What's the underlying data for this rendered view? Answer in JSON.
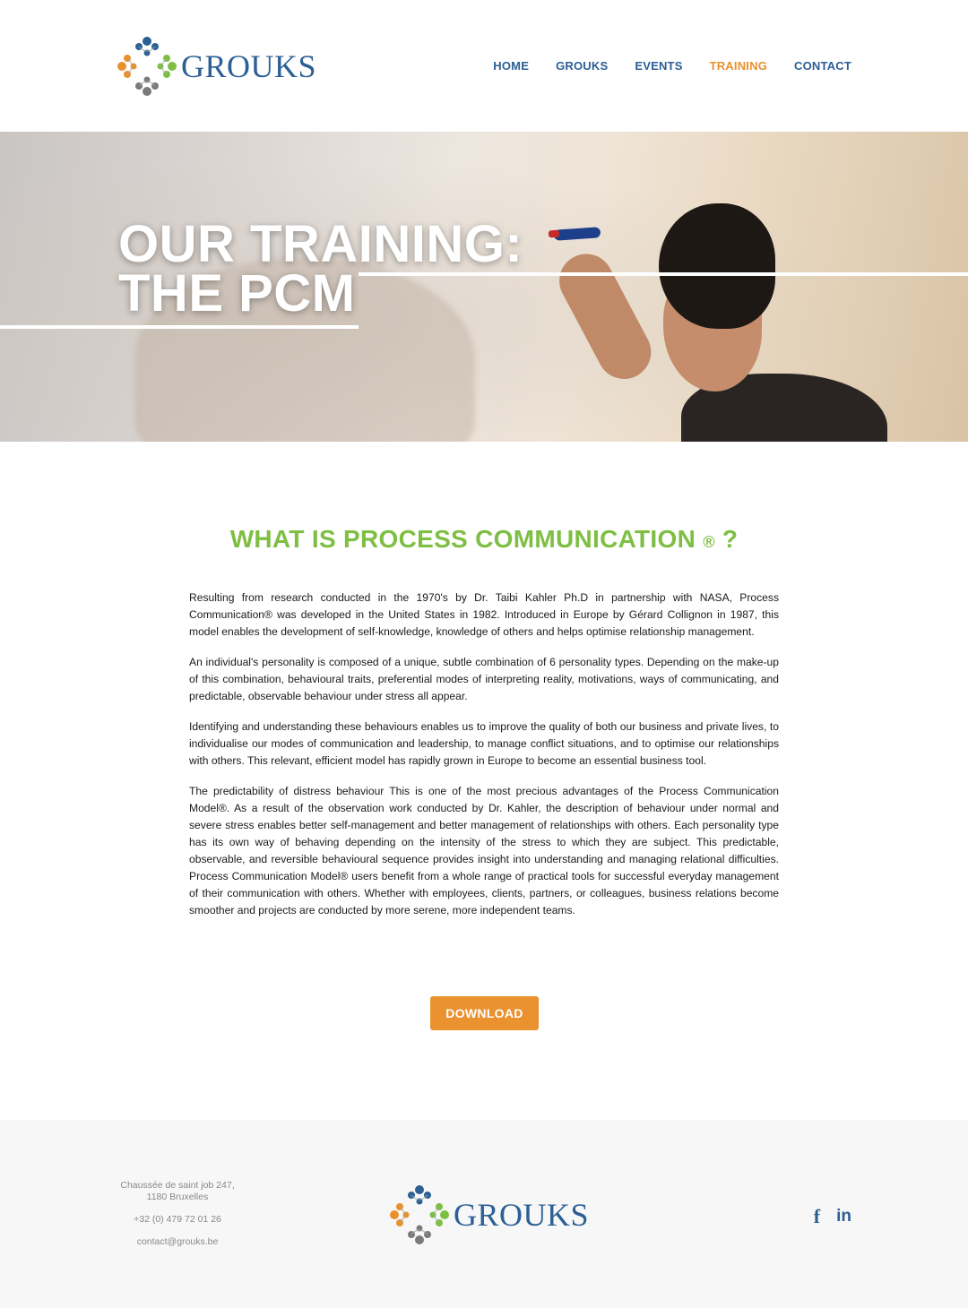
{
  "header": {
    "logo_text": "GROUKS",
    "nav": [
      {
        "label": "HOME",
        "active": false
      },
      {
        "label": "GROUKS",
        "active": false
      },
      {
        "label": "EVENTS",
        "active": false
      },
      {
        "label": "TRAINING",
        "active": true
      },
      {
        "label": "CONTACT",
        "active": false
      }
    ]
  },
  "hero": {
    "title_line1": "OUR TRAINING:",
    "title_line2": "THE PCM"
  },
  "content": {
    "heading": "WHAT IS PROCESS COMMUNICATION",
    "heading_reg": "®",
    "heading_q": "?",
    "paragraphs": [
      "Resulting from research conducted in the 1970's by Dr. Taibi Kahler Ph.D in partnership with NASA, Process Communication® was developed in the United States in 1982. Introduced in Europe by Gérard Collignon in 1987, this model enables the development of self-knowledge, knowledge of others and helps optimise relationship management.",
      "An individual's personality is composed of a unique, subtle combination of 6 personality types. Depending on the make-up of this combination, behavioural traits, preferential modes of interpreting reality, motivations, ways of communicating, and predictable, observable behaviour under stress all appear.",
      "Identifying and understanding these behaviours enables us to improve the quality of both our business and private lives, to individualise our modes of communication and leadership, to manage conflict situations, and to optimise our relationships with others. This relevant, efficient model has rapidly grown in Europe to become an essential business tool.",
      "The predictability of distress behaviour This is one of the most precious advantages of the Process Communication Model®. As a result of the observation work conducted by Dr. Kahler, the description of behaviour under normal and severe stress enables better self-management and better management of relationships with others. Each personality type has its own way of behaving depending on the intensity of the stress to which they are subject. This predictable, observable, and reversible behavioural sequence provides insight into understanding and managing relational difficulties. Process Communication Model® users benefit from a whole range of practical tools for successful everyday management of their communication with others. Whether with employees, clients, partners, or colleagues, business relations become smoother and projects are conducted by more serene, more independent teams."
    ],
    "download_label": "DOWNLOAD"
  },
  "footer": {
    "address_line1": "Chaussée de saint job 247,",
    "address_line2": "1180 Bruxelles",
    "phone": "+32 (0) 479 72 01 26",
    "email": "contact@grouks.be",
    "logo_text": "GROUKS",
    "social": [
      {
        "icon": "facebook-icon",
        "glyph": "f"
      },
      {
        "icon": "linkedin-icon",
        "glyph": "in"
      }
    ]
  },
  "colors": {
    "brand_blue": "#2c5f94",
    "accent_orange": "#ea9230",
    "heading_green": "#7ebf43",
    "logo_gray": "#7a7a7a"
  }
}
